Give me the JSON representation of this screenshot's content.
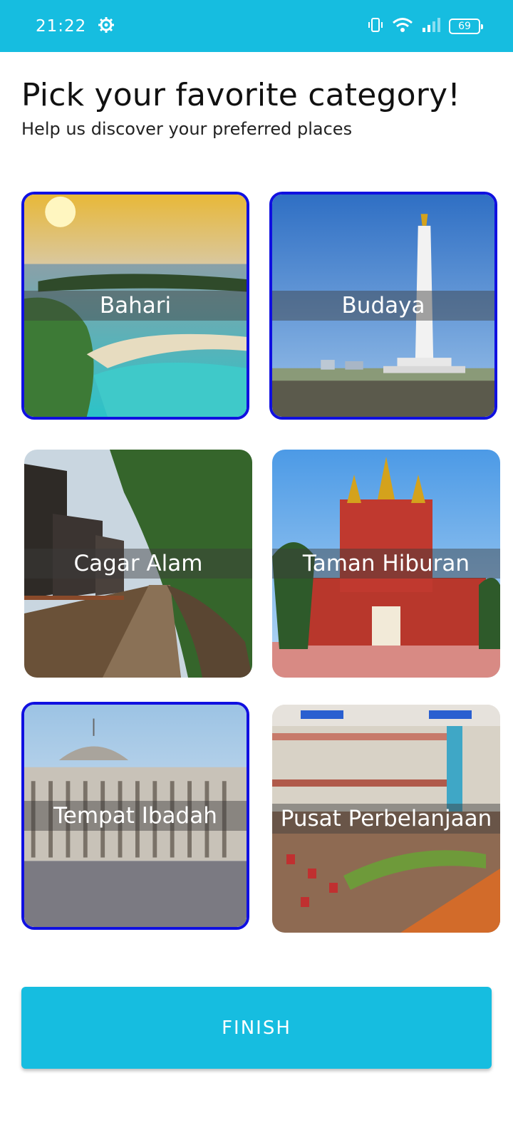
{
  "status_bar": {
    "time": "21:22",
    "battery": "69",
    "icons": [
      "gear-icon",
      "vibrate-icon",
      "wifi-icon",
      "signal-icon",
      "battery-icon"
    ]
  },
  "header": {
    "title": "Pick your favorite category!",
    "subtitle": "Help us discover your preferred places"
  },
  "categories": [
    {
      "label": "Bahari",
      "selected": true
    },
    {
      "label": "Budaya",
      "selected": true
    },
    {
      "label": "Cagar Alam",
      "selected": false
    },
    {
      "label": "Taman Hiburan",
      "selected": false
    },
    {
      "label": "Tempat Ibadah",
      "selected": true
    },
    {
      "label": "Pusat Perbelanjaan",
      "selected": false
    }
  ],
  "finish_button": {
    "label": "FINISH"
  },
  "colors": {
    "accent": "#16bde0",
    "selected_border": "#1010e0"
  }
}
